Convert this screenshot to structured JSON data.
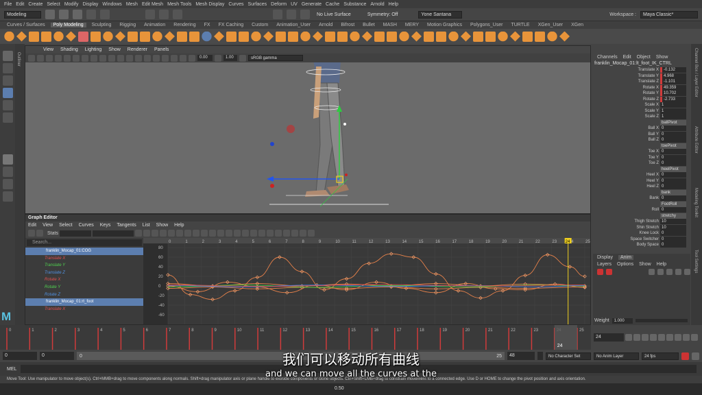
{
  "menubar": {
    "items": [
      "File",
      "Edit",
      "Create",
      "Select",
      "Modify",
      "Display",
      "Windows",
      "Mesh",
      "Edit Mesh",
      "Mesh Tools",
      "Mesh Display",
      "Curves",
      "Surfaces",
      "Deform",
      "UV",
      "Generate",
      "Cache",
      "Substance",
      "Arnold",
      "Help"
    ],
    "workspace_label": "Workspace :",
    "workspace_value": "Maya Classic*"
  },
  "statusline": {
    "mode": "Modeling",
    "live_surface": "No Live Surface",
    "symmetry": "Symmetry: Off",
    "user": "Yone Santana"
  },
  "shelf": {
    "tabs": [
      "Curves / Surfaces",
      "Poly Modeling",
      "Sculpting",
      "Rigging",
      "Animation",
      "Rendering",
      "FX",
      "FX Caching",
      "Custom",
      "Animation_User",
      "Arnold",
      "Bifrost",
      "Bullet",
      "MASH",
      "MERY",
      "Motion Graphics",
      "Polygons_User",
      "TURTLE",
      "XGen_User",
      "XGen"
    ],
    "active_tab": "Poly Modeling"
  },
  "viewport": {
    "menu": [
      "View",
      "Shading",
      "Lighting",
      "Show",
      "Renderer",
      "Panels"
    ],
    "exposure": "0.00",
    "gamma": "1.00",
    "color_space": "sRGB gamma"
  },
  "graph_editor": {
    "title": "Graph Editor",
    "menu": [
      "Edit",
      "View",
      "Select",
      "Curves",
      "Keys",
      "Tangents",
      "List",
      "Show",
      "Help"
    ],
    "stats_label": "Stats",
    "search_placeholder": "Search...",
    "outliner_rows": [
      {
        "label": "franklin_Mocap_01:COG",
        "type": "node",
        "color": "#ffffff"
      },
      {
        "label": "Translate X",
        "type": "attr",
        "color": "#e05050"
      },
      {
        "label": "Translate Y",
        "type": "attr",
        "color": "#50d050"
      },
      {
        "label": "Translate Z",
        "type": "attr",
        "color": "#5090e0"
      },
      {
        "label": "Rotate X",
        "type": "attr",
        "color": "#e05050"
      },
      {
        "label": "Rotate Y",
        "type": "attr",
        "color": "#50d050"
      },
      {
        "label": "Rotate Z",
        "type": "attr",
        "color": "#5090e0"
      },
      {
        "label": "franklin_Mocap_01:rt_foot",
        "type": "node",
        "color": "#ffffff"
      },
      {
        "label": "Translate X",
        "type": "attr",
        "color": "#e05050"
      }
    ],
    "frame_ticks": [
      "0",
      "1",
      "2",
      "3",
      "4",
      "5",
      "6",
      "7",
      "8",
      "9",
      "10",
      "11",
      "12",
      "13",
      "14",
      "15",
      "16",
      "17",
      "18",
      "19",
      "20",
      "21",
      "22",
      "23",
      "24",
      "25"
    ],
    "value_ticks": [
      "80",
      "60",
      "40",
      "20",
      "0",
      "-20",
      "-40",
      "-60"
    ],
    "current_frame": "24"
  },
  "channel_box": {
    "menu": [
      "Channels",
      "Edit",
      "Object",
      "Show"
    ],
    "node_name": "franklin_Mocap_01:lt_foot_IK_CTRL",
    "channels": [
      {
        "label": "Translate X",
        "value": "-0.132",
        "keyed": true
      },
      {
        "label": "Translate Y",
        "value": "4.968",
        "keyed": true
      },
      {
        "label": "Translate Z",
        "value": "-1.101",
        "keyed": true
      },
      {
        "label": "Rotate X",
        "value": "49.359",
        "keyed": true
      },
      {
        "label": "Rotate Y",
        "value": "10.702",
        "keyed": true
      },
      {
        "label": "Rotate Z",
        "value": "-2.733",
        "keyed": true
      },
      {
        "label": "Scale X",
        "value": "1",
        "keyed": false
      },
      {
        "label": "Scale Y",
        "value": "1",
        "keyed": false
      },
      {
        "label": "Scale Z",
        "value": "1",
        "keyed": false
      },
      {
        "label": "",
        "value": "ballPivot",
        "keyed": false,
        "header": true
      },
      {
        "label": "Ball X",
        "value": "0",
        "keyed": false
      },
      {
        "label": "Ball Y",
        "value": "0",
        "keyed": false
      },
      {
        "label": "Ball Z",
        "value": "0",
        "keyed": false
      },
      {
        "label": "",
        "value": "toePivot",
        "keyed": false,
        "header": true
      },
      {
        "label": "Toe X",
        "value": "0",
        "keyed": false
      },
      {
        "label": "Toe Y",
        "value": "0",
        "keyed": false
      },
      {
        "label": "Toe Z",
        "value": "0",
        "keyed": false
      },
      {
        "label": "",
        "value": "heelPivot",
        "keyed": false,
        "header": true
      },
      {
        "label": "Heel X",
        "value": "0",
        "keyed": false
      },
      {
        "label": "Heel Y",
        "value": "0",
        "keyed": false
      },
      {
        "label": "Heel Z",
        "value": "0",
        "keyed": false
      },
      {
        "label": "",
        "value": "bank",
        "keyed": false,
        "header": true
      },
      {
        "label": "Bank",
        "value": "0",
        "keyed": false
      },
      {
        "label": "",
        "value": "FootRoll",
        "keyed": false,
        "header": true
      },
      {
        "label": "Roll",
        "value": "0",
        "keyed": false
      },
      {
        "label": "",
        "value": "stretchy",
        "keyed": false,
        "header": true
      },
      {
        "label": "Thigh Stretch",
        "value": "10",
        "keyed": false
      },
      {
        "label": "Shin Stretch",
        "value": "10",
        "keyed": false
      },
      {
        "label": "Knee Lock",
        "value": "0",
        "keyed": false
      },
      {
        "label": "Space Switcher",
        "value": "0",
        "keyed": false
      },
      {
        "label": "Body Space",
        "value": "0",
        "keyed": false
      }
    ]
  },
  "layer_editor": {
    "tabs": [
      "Display",
      "Anim"
    ],
    "active_tab": "Anim",
    "menu": [
      "Layers",
      "Options",
      "Show",
      "Help"
    ],
    "weight_label": "Weight",
    "weight_value": "1.000"
  },
  "right_strip": [
    "Channel Box / Layer Editor",
    "Attribute Editor",
    "Modeling Toolkit",
    "Tool Settings"
  ],
  "outliner_strip": "Outliner",
  "time_slider": {
    "ticks": [
      "0",
      "1",
      "2",
      "3",
      "4",
      "5",
      "6",
      "7",
      "8",
      "9",
      "10",
      "11",
      "12",
      "13",
      "14",
      "15",
      "16",
      "17",
      "18",
      "19",
      "20",
      "21",
      "22",
      "23",
      "24",
      "25"
    ],
    "current_frame": "24",
    "current_frame_field": "24"
  },
  "range": {
    "start": "0",
    "playback_start": "0",
    "range_start_val": "0",
    "range_end_val": "25",
    "playback_end": "48",
    "character_set": "No Character Set",
    "anim_layer": "No Anim Layer",
    "fps": "24 fps"
  },
  "mel": {
    "label": "MEL"
  },
  "helpline": "Move Tool: Use manipulator to move object(s). Ctrl+MMB+drag to move components along normals. Shift+drag manipulator axis or plane handle to extrude components or clone objects. Ctrl+Shift+LMB+drag to constrain movement to a connected edge. Use D or HOME to change the pivot position and axis orientation.",
  "bottom_value": "0.50",
  "subtitles": {
    "zh": "我们可以移动所有曲线",
    "en": "and we can move all the curves at the"
  },
  "colors": {
    "accent_blue": "#5c7eaf",
    "key_red": "#d13b3b",
    "current_time_yellow": "#f0d020",
    "curve_orange": "#e8824a"
  }
}
